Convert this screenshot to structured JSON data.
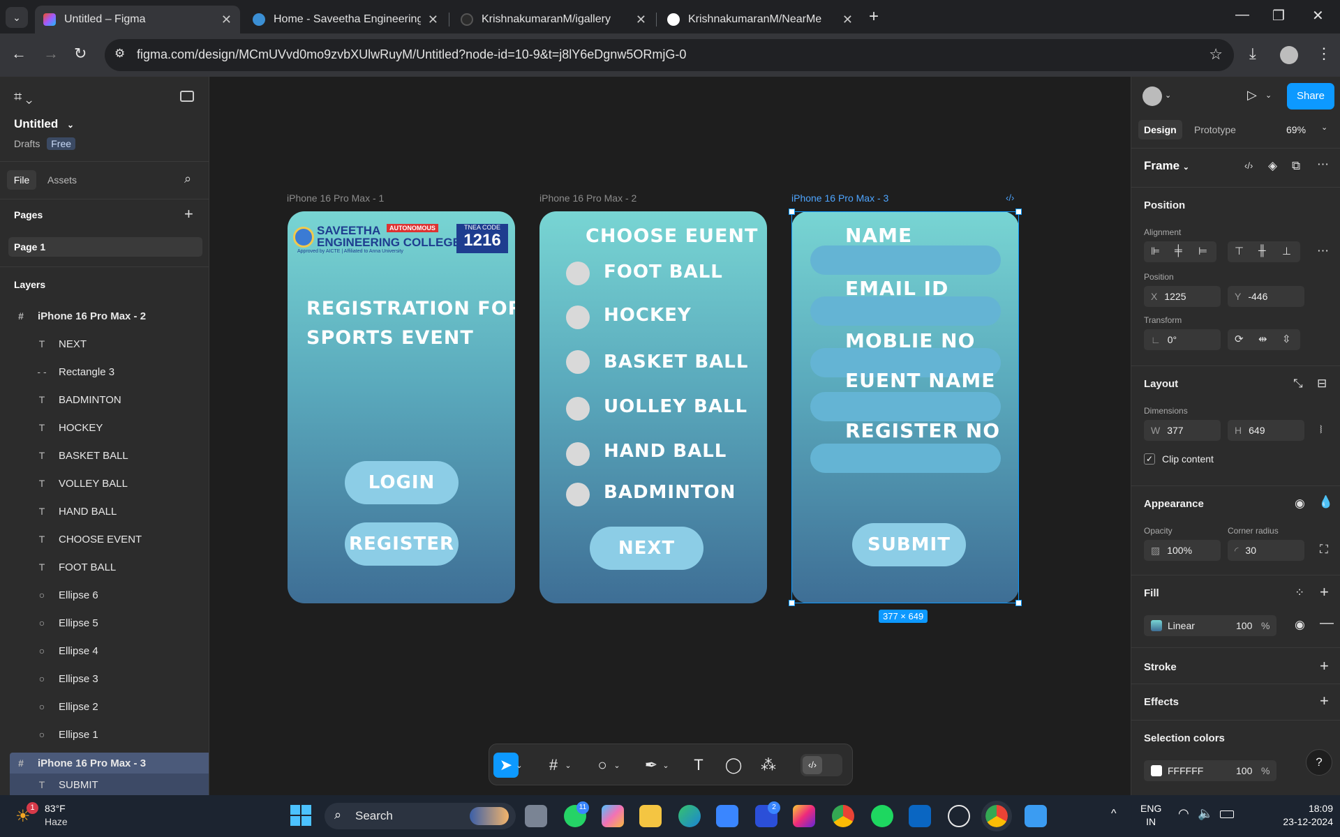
{
  "browser": {
    "tabs": [
      {
        "title": "Untitled – Figma",
        "active": true
      },
      {
        "title": "Home - Saveetha Engineering C",
        "active": false
      },
      {
        "title": "KrishnakumaranM/igallery",
        "active": false
      },
      {
        "title": "KrishnakumaranM/NearMe",
        "active": false
      }
    ],
    "url": "figma.com/design/MCmUVvd0mo9zvbXUlwRuyM/Untitled?node-id=10-9&t=j8lY6eDgnw5ORmjG-0"
  },
  "left_panel": {
    "file_name": "Untitled",
    "drafts_label": "Drafts",
    "plan_badge": "Free",
    "tab_file": "File",
    "tab_assets": "Assets",
    "pages_title": "Pages",
    "page_1": "Page 1",
    "layers_title": "Layers",
    "layers": [
      {
        "name": "iPhone 16 Pro Max - 2",
        "type": "frame"
      },
      {
        "name": "NEXT",
        "type": "text"
      },
      {
        "name": "Rectangle 3",
        "type": "rect"
      },
      {
        "name": "BADMINTON",
        "type": "text"
      },
      {
        "name": "HOCKEY",
        "type": "text"
      },
      {
        "name": "BASKET BALL",
        "type": "text"
      },
      {
        "name": "VOLLEY BALL",
        "type": "text"
      },
      {
        "name": "HAND BALL",
        "type": "text"
      },
      {
        "name": "CHOOSE EVENT",
        "type": "text"
      },
      {
        "name": "FOOT BALL",
        "type": "text"
      },
      {
        "name": "Ellipse 6",
        "type": "ellipse"
      },
      {
        "name": "Ellipse 5",
        "type": "ellipse"
      },
      {
        "name": "Ellipse 4",
        "type": "ellipse"
      },
      {
        "name": "Ellipse 3",
        "type": "ellipse"
      },
      {
        "name": "Ellipse 2",
        "type": "ellipse"
      },
      {
        "name": "Ellipse 1",
        "type": "ellipse"
      },
      {
        "name": "iPhone 16 Pro Max - 3",
        "type": "frame"
      },
      {
        "name": "SUBMIT",
        "type": "text"
      }
    ]
  },
  "canvas": {
    "frame1": {
      "label": "iPhone 16 Pro Max - 1",
      "logo_line1": "SAVEETHA",
      "logo_autonomous": "AUTONOMOUS",
      "logo_line2": "ENGINEERING COLLEGE",
      "logo_approved": "Approved by AICTE | Affiliated to Anna University",
      "tnea_label": "TNEA CODE",
      "tnea_code": "1216",
      "title_line1": "REGISTRATION FOR",
      "title_line2": "SPORTS EVENT",
      "btn_login": "LOGIN",
      "btn_register": "REGISTER"
    },
    "frame2": {
      "label": "iPhone 16 Pro Max - 2",
      "title": "CHOOSE EUENT",
      "options": [
        "FOOT BALL",
        "HOCKEY",
        "BASKET BALL",
        "UOLLEY BALL",
        "HAND  BALL",
        "BADMINTON"
      ],
      "btn_next": "NEXT"
    },
    "frame3": {
      "label": "iPhone 16 Pro Max - 3",
      "fields": [
        "NAME",
        "EMAIL ID",
        "MOBLIE NO",
        "EUENT NAME",
        "REGISTER NO"
      ],
      "btn_submit": "SUBMIT",
      "size_badge": "377 × 649"
    }
  },
  "right_panel": {
    "share": "Share",
    "tab_design": "Design",
    "tab_prototype": "Prototype",
    "zoom": "69%",
    "frame_title": "Frame",
    "position_title": "Position",
    "alignment_label": "Alignment",
    "position_label": "Position",
    "x_label": "X",
    "x_value": "1225",
    "y_label": "Y",
    "y_value": "-446",
    "transform_label": "Transform",
    "rotation": "0°",
    "layout_title": "Layout",
    "dimensions_label": "Dimensions",
    "w_label": "W",
    "w_value": "377",
    "h_label": "H",
    "h_value": "649",
    "clip_content": "Clip content",
    "appearance_title": "Appearance",
    "opacity_label": "Opacity",
    "opacity_value": "100%",
    "corner_label": "Corner radius",
    "corner_value": "30",
    "fill_title": "Fill",
    "fill_type": "Linear",
    "fill_opacity": "100",
    "percent": "%",
    "stroke_title": "Stroke",
    "effects_title": "Effects",
    "selection_colors_title": "Selection colors",
    "sel_color_hex": "FFFFFF",
    "sel_color_opacity": "100"
  },
  "taskbar": {
    "weather_temp": "83°F",
    "weather_desc": "Haze",
    "weather_badge": "1",
    "search": "Search",
    "whatsapp_badge": "11",
    "l_badge": "2",
    "lang1": "ENG",
    "lang2": "IN",
    "time": "18:09",
    "date": "23-12-2024"
  },
  "colors": {
    "accent": "#0d99ff",
    "phone_top": "#78d5d3",
    "phone_bottom": "#3e6e95",
    "button": "#8ccde6"
  }
}
